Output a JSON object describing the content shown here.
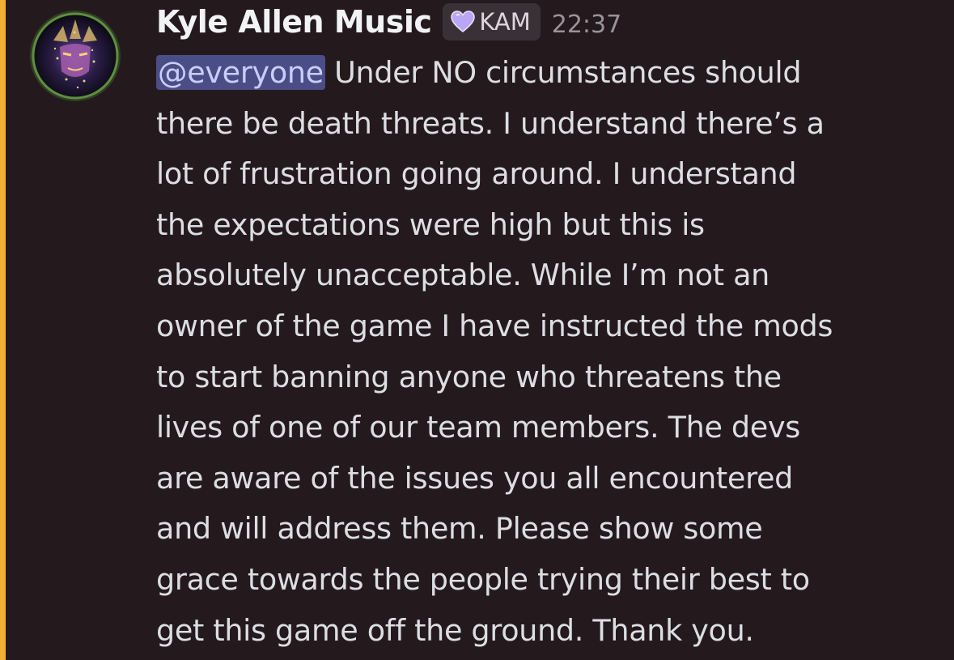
{
  "message": {
    "author": "Kyle Allen Music",
    "role_tag": "KAM",
    "role_tag_icon": "heart-icon",
    "timestamp": "22:37",
    "mention": "@everyone",
    "lines": [
      " Under NO circumstances should",
      "there be death threats. I understand there’s a",
      "lot of frustration going around. I understand",
      "the expectations were high but this is",
      "absolutely unacceptable. While I’m not an",
      "owner of the game I have instructed the mods",
      "to start banning anyone who threatens the",
      "lives of one of our team members. The devs",
      "are aware of the issues you all encountered",
      "and will address them. Please show some",
      "grace towards the people trying their best to",
      "get this game off the ground. Thank you."
    ]
  },
  "colors": {
    "background": "#241a1e",
    "mention_highlight_bar": "#f0b132",
    "mention_background": "#4b4d86",
    "mention_text": "#c9cdfb",
    "tag_heart": "#b9a6f5"
  }
}
